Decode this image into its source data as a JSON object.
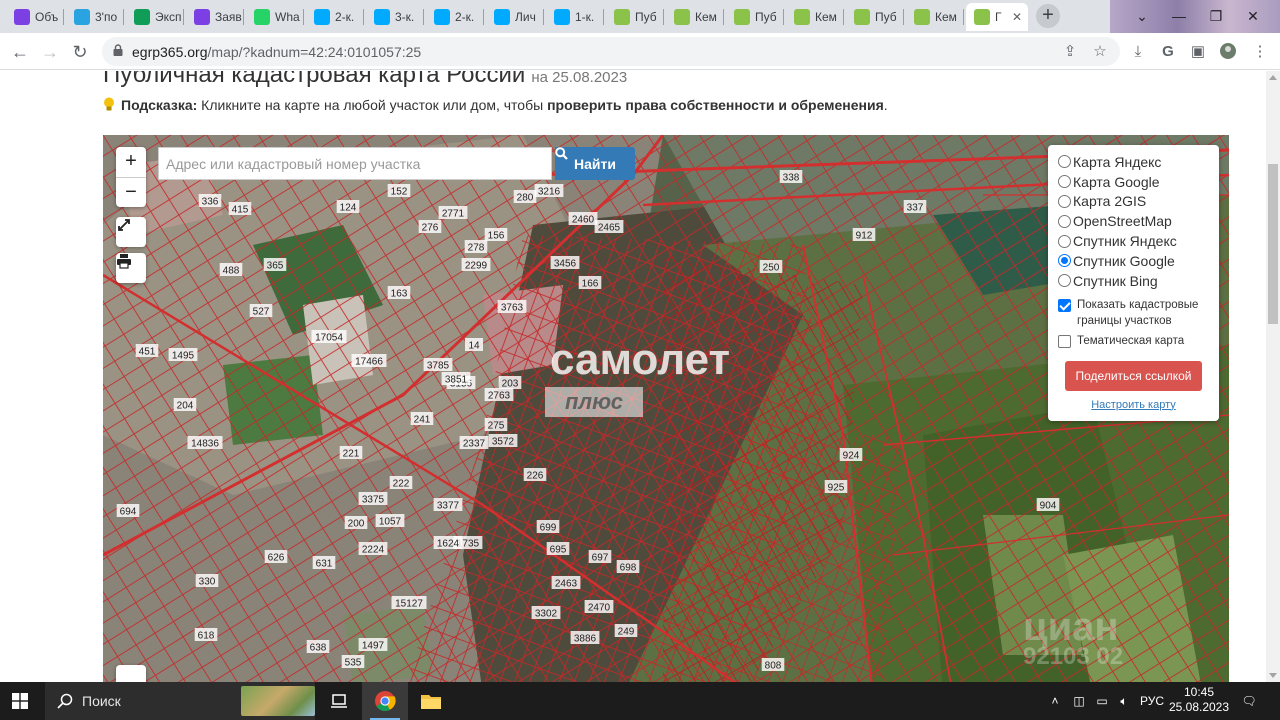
{
  "browser": {
    "tabs": [
      {
        "label": "Объ",
        "icon": "mail-icon",
        "color": "#7b3fe4"
      },
      {
        "label": "3'по",
        "icon": "telegram-icon",
        "color": "#2aa3e1"
      },
      {
        "label": "Эксп",
        "icon": "sheets-icon",
        "color": "#0f9d58"
      },
      {
        "label": "Заяв",
        "icon": "mail-icon",
        "color": "#7b3fe4"
      },
      {
        "label": "Wha",
        "icon": "whatsapp-icon",
        "color": "#25d366"
      },
      {
        "label": "2-к.",
        "icon": "avito-icon",
        "color": "#00aaff"
      },
      {
        "label": "3-к.",
        "icon": "avito-icon",
        "color": "#00aaff"
      },
      {
        "label": "2-к.",
        "icon": "avito-icon",
        "color": "#00aaff"
      },
      {
        "label": "Лич",
        "icon": "avito-icon",
        "color": "#00aaff"
      },
      {
        "label": "1-к.",
        "icon": "avito-icon",
        "color": "#00aaff"
      },
      {
        "label": "Пуб",
        "icon": "check-icon",
        "color": "#8bc34a"
      },
      {
        "label": "Кем",
        "icon": "check-icon",
        "color": "#8bc34a"
      },
      {
        "label": "Пуб",
        "icon": "check-icon",
        "color": "#8bc34a"
      },
      {
        "label": "Кем",
        "icon": "check-icon",
        "color": "#8bc34a"
      },
      {
        "label": "Пуб",
        "icon": "check-icon",
        "color": "#8bc34a"
      },
      {
        "label": "Кем",
        "icon": "check-icon",
        "color": "#8bc34a"
      },
      {
        "label": "Г",
        "icon": "check-icon",
        "color": "#8bc34a",
        "active": true
      }
    ],
    "url_host": "egrp365.org",
    "url_rest": "/map/?kadnum=42:24:0101057:25"
  },
  "page": {
    "title": "Публичная кадастровая карта России",
    "title_date": "на 25.08.2023",
    "hint_label": "Подсказка:",
    "hint_text": " Кликните на карте на любой участок или дом, чтобы ",
    "hint_bold": "проверить права собственности и обременения",
    "hint_end": "."
  },
  "map": {
    "zoom_in": "+",
    "zoom_out": "−",
    "search_placeholder": "Адрес или кадастровый номер участка",
    "find_label": "Найти",
    "layers": [
      {
        "label": "Карта Яндекс",
        "selected": false
      },
      {
        "label": "Карта Google",
        "selected": false
      },
      {
        "label": "Карта 2GIS",
        "selected": false
      },
      {
        "label": "OpenStreetMap",
        "selected": false
      },
      {
        "label": "Спутник Яндекс",
        "selected": false
      },
      {
        "label": "Спутник Google",
        "selected": true
      },
      {
        "label": "Спутник Bing",
        "selected": false
      }
    ],
    "show_borders_label": "Показать кадастровые границы участков",
    "show_borders_checked": true,
    "thematic_label": "Тематическая карта",
    "thematic_checked": false,
    "share_label": "Поделиться ссылкой",
    "setup_label": "Настроить карту",
    "watermark_main": "самолет",
    "watermark_sub": "плюс",
    "watermark_cian": "циан",
    "watermark_cian_id": "92103 02",
    "parcel_labels": [
      "152",
      "3216",
      "280",
      "2460",
      "338",
      "336",
      "415",
      "124",
      "276",
      "2771",
      "156",
      "2299",
      "2465",
      "365",
      "278",
      "3456",
      "250",
      "912",
      "337",
      "488",
      "163",
      "3763",
      "166",
      "527",
      "17054",
      "17466",
      "451",
      "1495",
      "14",
      "3785",
      "3156",
      "203",
      "241",
      "204",
      "14836",
      "2763",
      "3851",
      "275",
      "221",
      "226",
      "222",
      "3572",
      "2337",
      "3375",
      "904",
      "924",
      "925",
      "694",
      "200",
      "2224",
      "1057",
      "3377",
      "1735",
      "699",
      "695",
      "697",
      "698",
      "2463",
      "2470",
      "330",
      "626",
      "631",
      "15127",
      "3302",
      "3886",
      "249",
      "618",
      "638",
      "808",
      "535",
      "1497",
      "1624"
    ]
  },
  "taskbar": {
    "search_label": "Поиск",
    "lang": "РУС",
    "time": "10:45",
    "date": "25.08.2023"
  },
  "colors": {
    "accent": "#337ab7",
    "share": "#d9534f",
    "parcel": "#d32f2f"
  }
}
